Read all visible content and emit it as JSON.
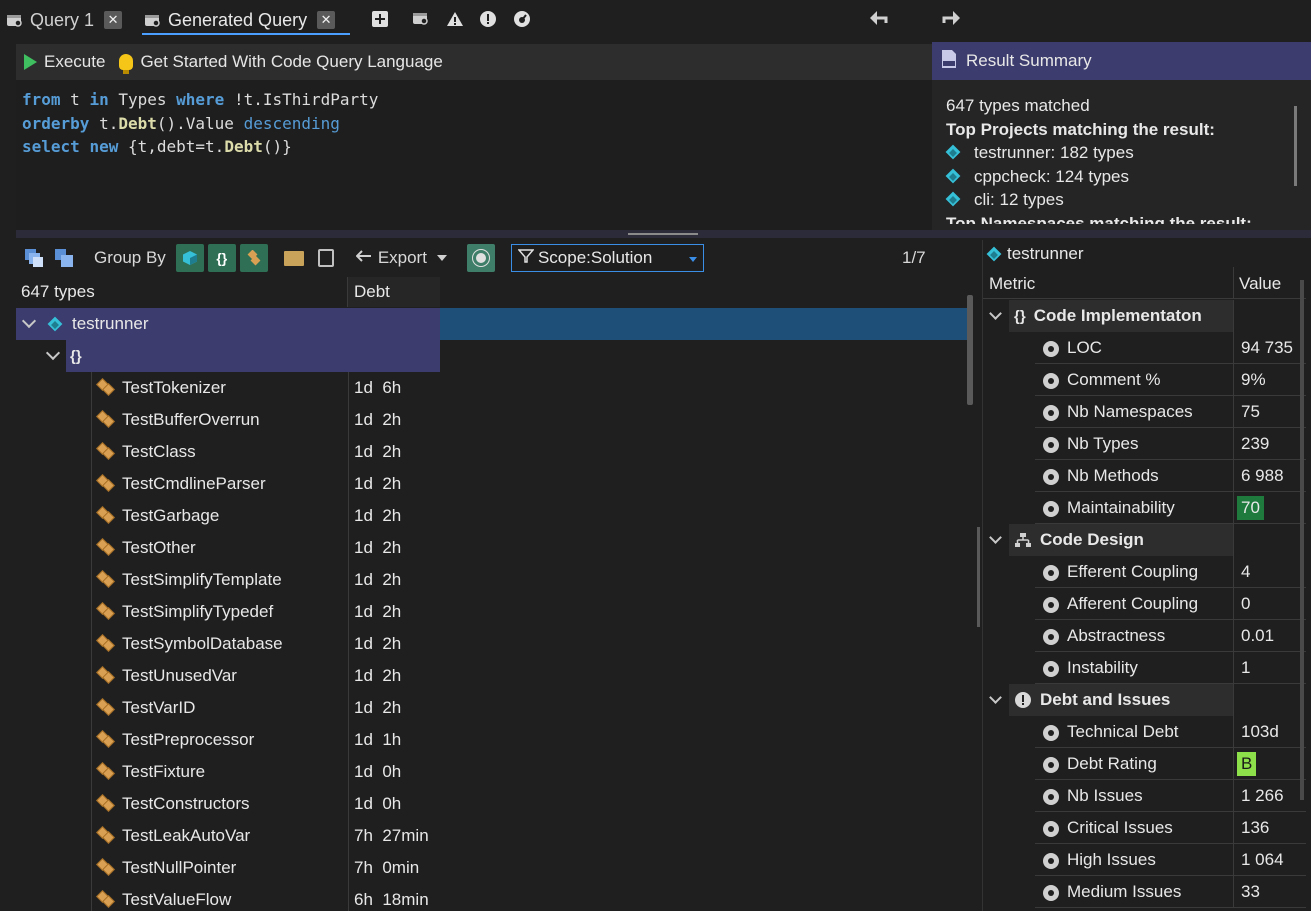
{
  "tabs": [
    {
      "label": "Query 1",
      "active": false
    },
    {
      "label": "Generated Query",
      "active": true
    }
  ],
  "query_toolbar": {
    "execute_label": "Execute",
    "get_started_label": "Get Started With Code Query Language"
  },
  "editor": {
    "lines": [
      [
        {
          "t": "from",
          "c": "kw"
        },
        {
          "t": " t ",
          "c": "tx"
        },
        {
          "t": "in",
          "c": "kw"
        },
        {
          "t": " Types ",
          "c": "tx"
        },
        {
          "t": "where",
          "c": "kw"
        },
        {
          "t": " !t.IsThirdParty",
          "c": "tx"
        }
      ],
      [
        {
          "t": "orderby",
          "c": "kw"
        },
        {
          "t": " t.",
          "c": "tx"
        },
        {
          "t": "Debt",
          "c": "fn"
        },
        {
          "t": "().Value ",
          "c": "tx"
        },
        {
          "t": "descending",
          "c": "kw2"
        }
      ],
      [
        {
          "t": "select",
          "c": "kw"
        },
        {
          "t": " ",
          "c": "tx"
        },
        {
          "t": "new",
          "c": "kw"
        },
        {
          "t": " {t,debt=t.",
          "c": "tx"
        },
        {
          "t": "Debt",
          "c": "fn"
        },
        {
          "t": "()}",
          "c": "tx"
        }
      ]
    ]
  },
  "summary": {
    "title": "Result Summary",
    "matched": "647 types  matched",
    "top_projects_heading": "Top Projects matching the result:",
    "projects": [
      "testrunner: 182 types",
      "cppcheck: 124 types",
      "cli: 12 types"
    ],
    "next_heading": "Top Namespaces matching the result:"
  },
  "results_toolbar": {
    "group_by_label": "Group By",
    "export_label": "Export",
    "scope_label": "Scope:Solution",
    "page": "1/7"
  },
  "grid": {
    "col_name": "647 types",
    "col_debt": "Debt",
    "project": "testrunner",
    "namespace": "{}",
    "rows": [
      {
        "name": "TestTokenizer",
        "debt": "1d  6h"
      },
      {
        "name": "TestBufferOverrun",
        "debt": "1d  2h"
      },
      {
        "name": "TestClass",
        "debt": "1d  2h"
      },
      {
        "name": "TestCmdlineParser",
        "debt": "1d  2h"
      },
      {
        "name": "TestGarbage",
        "debt": "1d  2h"
      },
      {
        "name": "TestOther",
        "debt": "1d  2h"
      },
      {
        "name": "TestSimplifyTemplate",
        "debt": "1d  2h"
      },
      {
        "name": "TestSimplifyTypedef",
        "debt": "1d  2h"
      },
      {
        "name": "TestSymbolDatabase",
        "debt": "1d  2h"
      },
      {
        "name": "TestUnusedVar",
        "debt": "1d  2h"
      },
      {
        "name": "TestVarID",
        "debt": "1d  2h"
      },
      {
        "name": "TestPreprocessor",
        "debt": "1d  1h"
      },
      {
        "name": "TestFixture",
        "debt": "1d  0h"
      },
      {
        "name": "TestConstructors",
        "debt": "1d  0h"
      },
      {
        "name": "TestLeakAutoVar",
        "debt": "7h  27min"
      },
      {
        "name": "TestNullPointer",
        "debt": "7h  0min"
      },
      {
        "name": "TestValueFlow",
        "debt": "6h  18min"
      }
    ]
  },
  "metrics": {
    "title": "testrunner",
    "col_metric": "Metric",
    "col_value": "Value",
    "groups": [
      {
        "label": "Code Implementaton",
        "icon": "braces-icon",
        "rows": [
          {
            "label": "LOC",
            "value": "94 735"
          },
          {
            "label": "Comment %",
            "value": "9%"
          },
          {
            "label": "Nb Namespaces",
            "value": "75"
          },
          {
            "label": "Nb Types",
            "value": "239"
          },
          {
            "label": "Nb Methods",
            "value": "6 988"
          },
          {
            "label": "Maintainability",
            "value": "70",
            "badge": "#1f7a3e"
          }
        ]
      },
      {
        "label": "Code Design",
        "icon": "hierarchy-icon",
        "rows": [
          {
            "label": "Efferent Coupling",
            "value": "4"
          },
          {
            "label": "Afferent Coupling",
            "value": "0"
          },
          {
            "label": "Abstractness",
            "value": "0.01"
          },
          {
            "label": "Instability",
            "value": "1"
          }
        ]
      },
      {
        "label": "Debt and Issues",
        "icon": "warning-icon",
        "rows": [
          {
            "label": "Technical Debt",
            "value": "103d"
          },
          {
            "label": "Debt Rating",
            "value": "B",
            "badge": "#8ee04a",
            "badge_text": "#1a1a1a"
          },
          {
            "label": "Nb Issues",
            "value": "1 266"
          },
          {
            "label": "Critical Issues",
            "value": "136"
          },
          {
            "label": "High Issues",
            "value": "1 064"
          },
          {
            "label": "Medium Issues",
            "value": "33"
          }
        ]
      }
    ]
  },
  "colors": {
    "selection": "#3c3c6e",
    "accent_blue": "#4a9fff",
    "group_green": "#2f6f55"
  }
}
